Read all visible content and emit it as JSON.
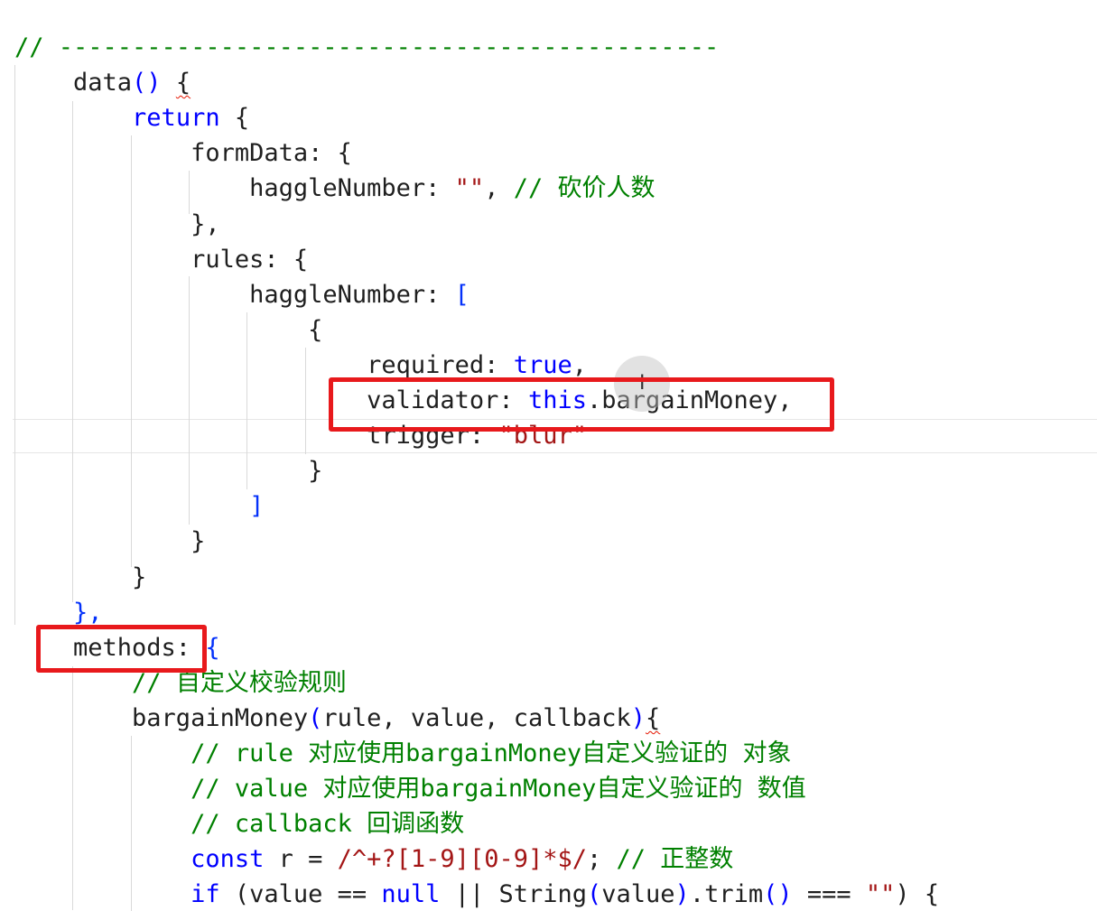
{
  "editor": {
    "language": "javascript",
    "lines": [
      [
        {
          "t": "// ---------------------------------------------",
          "c": "cmt"
        }
      ],
      [
        {
          "t": "    data",
          "c": "plain"
        },
        {
          "t": "()",
          "c": "kw"
        },
        {
          "t": " ",
          "c": "plain"
        },
        {
          "t": "{",
          "c": "brk",
          "sq": true
        }
      ],
      [
        {
          "t": "        ",
          "c": "plain"
        },
        {
          "t": "return",
          "c": "kw"
        },
        {
          "t": " {",
          "c": "plain"
        }
      ],
      [
        {
          "t": "            formData: {",
          "c": "plain"
        }
      ],
      [
        {
          "t": "                haggleNumber: ",
          "c": "plain"
        },
        {
          "t": "\"\"",
          "c": "str"
        },
        {
          "t": ", ",
          "c": "plain"
        },
        {
          "t": "// 砍价人数",
          "c": "cmt"
        }
      ],
      [
        {
          "t": "            },",
          "c": "plain"
        }
      ],
      [
        {
          "t": "            rules: {",
          "c": "plain"
        }
      ],
      [
        {
          "t": "                haggleNumber: ",
          "c": "plain"
        },
        {
          "t": "[",
          "c": "brk-blue"
        }
      ],
      [
        {
          "t": "                    {",
          "c": "plain"
        }
      ],
      [
        {
          "t": "                        required: ",
          "c": "plain"
        },
        {
          "t": "true",
          "c": "kw"
        },
        {
          "t": ",",
          "c": "plain"
        }
      ],
      [
        {
          "t": "                        validator: ",
          "c": "plain"
        },
        {
          "t": "this",
          "c": "kw"
        },
        {
          "t": ".bargainMoney,",
          "c": "plain"
        }
      ],
      [
        {
          "t": "                        trigger: ",
          "c": "plain"
        },
        {
          "t": "\"blur\"",
          "c": "str"
        }
      ],
      [
        {
          "t": "                    }",
          "c": "plain"
        }
      ],
      [
        {
          "t": "                ",
          "c": "plain"
        },
        {
          "t": "]",
          "c": "brk-blue"
        }
      ],
      [
        {
          "t": "            }",
          "c": "plain"
        }
      ],
      [
        {
          "t": "        }",
          "c": "plain"
        }
      ],
      [
        {
          "t": "    ",
          "c": "plain"
        },
        {
          "t": "},",
          "c": "brk-blue"
        }
      ],
      [
        {
          "t": "    methods: ",
          "c": "plain"
        },
        {
          "t": "{",
          "c": "brk-blue"
        }
      ],
      [
        {
          "t": "        ",
          "c": "plain"
        },
        {
          "t": "// 自定义校验规则",
          "c": "cmt"
        }
      ],
      [
        {
          "t": "        bargainMoney",
          "c": "plain"
        },
        {
          "t": "(",
          "c": "kw"
        },
        {
          "t": "rule, value, callback",
          "c": "plain"
        },
        {
          "t": ")",
          "c": "kw"
        },
        {
          "t": "{",
          "c": "brk",
          "sq": true
        }
      ],
      [
        {
          "t": "            ",
          "c": "plain"
        },
        {
          "t": "// rule 对应使用bargainMoney自定义验证的 对象",
          "c": "cmt"
        }
      ],
      [
        {
          "t": "            ",
          "c": "plain"
        },
        {
          "t": "// value 对应使用bargainMoney自定义验证的 数值",
          "c": "cmt"
        }
      ],
      [
        {
          "t": "            ",
          "c": "plain"
        },
        {
          "t": "// callback 回调函数",
          "c": "cmt"
        }
      ],
      [
        {
          "t": "            ",
          "c": "plain"
        },
        {
          "t": "const",
          "c": "kw"
        },
        {
          "t": " r = ",
          "c": "plain"
        },
        {
          "t": "/^+?[1-9][0-9]*$/",
          "c": "str"
        },
        {
          "t": "; ",
          "c": "plain"
        },
        {
          "t": "// 正整数",
          "c": "cmt"
        }
      ],
      [
        {
          "t": "            ",
          "c": "plain"
        },
        {
          "t": "if",
          "c": "kw"
        },
        {
          "t": " (value == ",
          "c": "plain"
        },
        {
          "t": "null",
          "c": "kw"
        },
        {
          "t": " || String",
          "c": "plain"
        },
        {
          "t": "(",
          "c": "kw"
        },
        {
          "t": "value",
          "c": "plain"
        },
        {
          "t": ")",
          "c": "kw"
        },
        {
          "t": ".trim",
          "c": "plain"
        },
        {
          "t": "()",
          "c": "kw"
        },
        {
          "t": " === ",
          "c": "plain"
        },
        {
          "t": "\"\"",
          "c": "str"
        },
        {
          "t": ") {",
          "c": "plain"
        }
      ]
    ]
  },
  "annotations": {
    "highlight_color": "#e8191c",
    "boxes": [
      {
        "label": "validator-line-highlight"
      },
      {
        "label": "methods-key-highlight"
      }
    ]
  },
  "colors": {
    "keyword": "#0000ff",
    "string": "#a31515",
    "comment": "#008000",
    "text": "#1f1f1f"
  }
}
